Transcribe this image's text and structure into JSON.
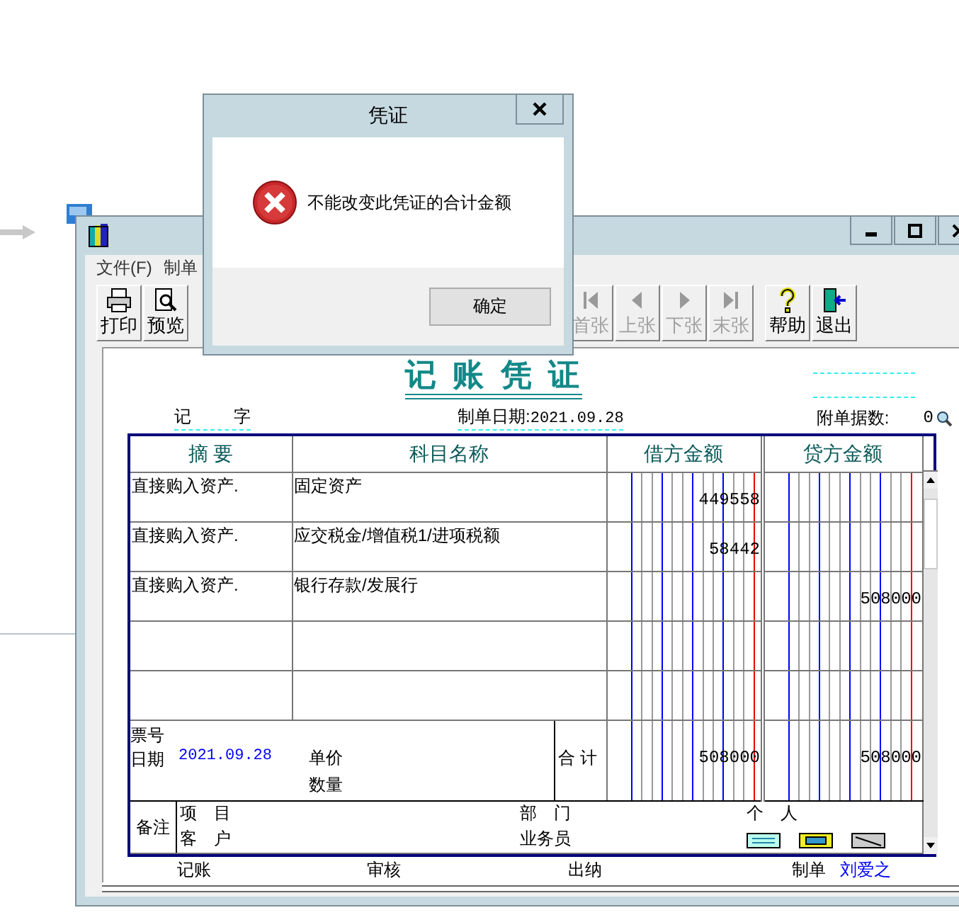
{
  "main_window": {
    "menu": [
      "文件(F)",
      "制单"
    ],
    "toolbar": {
      "left": [
        {
          "label": "打印",
          "kind": "printer",
          "disabled": false
        },
        {
          "label": "预览",
          "kind": "preview",
          "disabled": false
        }
      ],
      "nav": [
        {
          "label": "首张",
          "kind": "first",
          "disabled": true
        },
        {
          "label": "上张",
          "kind": "prev",
          "disabled": true
        },
        {
          "label": "下张",
          "kind": "next",
          "disabled": true
        },
        {
          "label": "末张",
          "kind": "last",
          "disabled": true
        }
      ],
      "right": [
        {
          "label": "帮助",
          "kind": "help",
          "disabled": false
        },
        {
          "label": "退出",
          "kind": "exit",
          "disabled": false
        }
      ]
    },
    "voucher": {
      "title": "记 账 凭 证",
      "type": "记",
      "type_suffix": "字",
      "date_label": "制单日期:",
      "date": "2021.09.28",
      "attach_label": "附单据数:",
      "attach_count": "0",
      "columns": [
        "摘 要",
        "科目名称",
        "借方金额",
        "贷方金额"
      ],
      "rows": [
        {
          "summary": "直接购入资产.",
          "account": "固定资产",
          "debit": "449558"
        },
        {
          "summary": "直接购入资产.",
          "account": "应交税金/增值税1/进项税额",
          "debit": "58442"
        },
        {
          "summary": "直接购入资产.",
          "account": "银行存款/发展行",
          "credit": "508000"
        }
      ],
      "totals": {
        "ticket_label": "票号",
        "date_label": "日期",
        "date": "2021.09.28",
        "price_label": "单价",
        "qty_label": "数量",
        "total_label": "合 计",
        "debit": "508000",
        "credit": "508000"
      },
      "notes": {
        "label": "备注",
        "project_label": "项　目",
        "customer_label": "客　户",
        "dept_label": "部　门",
        "staff_label": "业务员",
        "person_label": "个　人"
      },
      "signatures": [
        {
          "label": "记账"
        },
        {
          "label": "审核"
        },
        {
          "label": "出纳"
        },
        {
          "label": "制单",
          "value": "刘爱之"
        }
      ]
    }
  },
  "dialog": {
    "title": "凭证",
    "message": "不能改变此凭证的合计金额",
    "button": "确定"
  }
}
